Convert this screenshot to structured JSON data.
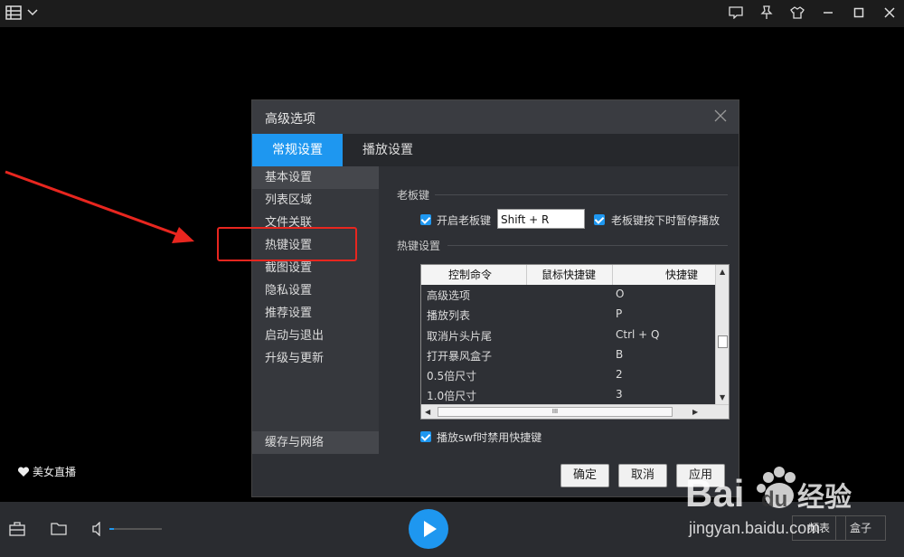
{
  "colors": {
    "accent": "#1e97f0",
    "annotation": "#e8261f"
  },
  "dialog": {
    "title": "高级选项",
    "tabs": [
      {
        "label": "常规设置",
        "active": true
      },
      {
        "label": "播放设置",
        "active": false
      }
    ],
    "sidebar": {
      "items": [
        "基本设置",
        "列表区域",
        "文件关联",
        "热键设置",
        "截图设置",
        "隐私设置",
        "推荐设置",
        "启动与退出",
        "升级与更新"
      ],
      "selected": "基本设置",
      "bottom_item": "缓存与网络"
    },
    "boss_key": {
      "section_title": "老板键",
      "enable_label": "开启老板键",
      "enable_checked": true,
      "hotkey_value": "Shift + R",
      "pause_label": "老板键按下时暂停播放",
      "pause_checked": true
    },
    "hotkeys": {
      "section_title": "热键设置",
      "columns": [
        "控制命令",
        "鼠标快捷键",
        "快捷键"
      ],
      "rows": [
        {
          "command": "高级选项",
          "mouse": "",
          "key": "O"
        },
        {
          "command": "播放列表",
          "mouse": "",
          "key": "P"
        },
        {
          "command": "取消片头片尾",
          "mouse": "",
          "key": "Ctrl + Q"
        },
        {
          "command": "打开暴风盒子",
          "mouse": "",
          "key": "B"
        },
        {
          "command": "0.5倍尺寸",
          "mouse": "",
          "key": "2"
        },
        {
          "command": "1.0倍尺寸",
          "mouse": "",
          "key": "3"
        }
      ],
      "scroll_thumb_label": "III",
      "swf_disable_label": "播放swf时禁用快捷键",
      "swf_disable_checked": true
    },
    "buttons": {
      "ok": "确定",
      "cancel": "取消",
      "apply": "应用"
    }
  },
  "player": {
    "live_label": "美女直播",
    "bottom_right_1": "频表",
    "bottom_right_2": "盒子",
    "volume_level": 0.08
  },
  "watermark": {
    "brand": "Bai",
    "brand2": "du",
    "sub": "经验",
    "url": "jingyan.baidu.com"
  }
}
